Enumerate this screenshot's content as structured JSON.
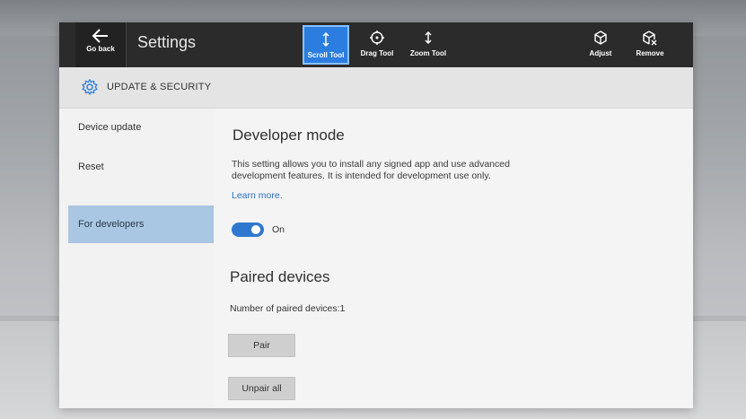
{
  "toolbar": {
    "back_label": "Go back",
    "app_title": "Settings",
    "tools": [
      {
        "label": "Scroll Tool",
        "icon": "scroll-icon",
        "active": true
      },
      {
        "label": "Drag Tool",
        "icon": "drag-icon",
        "active": false
      },
      {
        "label": "Zoom Tool",
        "icon": "zoom-icon",
        "active": false
      }
    ],
    "adjust_label": "Adjust",
    "remove_label": "Remove"
  },
  "section": {
    "title": "UPDATE & SECURITY",
    "icon": "gear-icon"
  },
  "sidebar": {
    "items": [
      {
        "label": "Device update",
        "selected": false
      },
      {
        "label": "Reset",
        "selected": false
      },
      {
        "label": "For developers",
        "selected": true
      }
    ]
  },
  "developer_mode": {
    "heading": "Developer mode",
    "description": "This setting allows you to install any signed app and use advanced development features. It is intended for development use only.",
    "learn_more": "Learn more.",
    "toggle_state": "On"
  },
  "paired_devices": {
    "heading": "Paired devices",
    "count_text": "Number of paired devices:1",
    "pair_label": "Pair",
    "unpair_label": "Unpair all"
  },
  "colors": {
    "accent": "#2c7de0",
    "toolbar_bg": "#2b2b2b",
    "selected_item": "#a9c6e2",
    "link": "#2b6fc4"
  }
}
